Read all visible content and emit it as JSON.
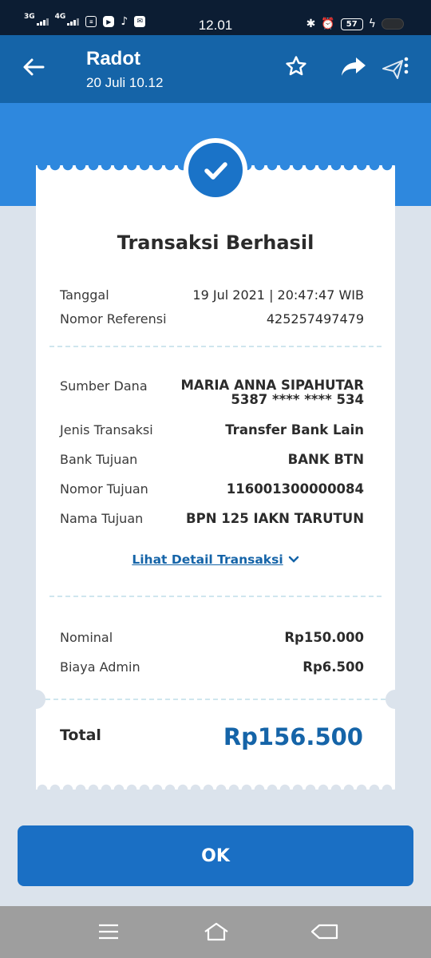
{
  "status_bar": {
    "network1": "3G",
    "network2": "4G",
    "time": "12.01",
    "battery": "57"
  },
  "header": {
    "sender": "Radot",
    "date": "20 Juli 10.12"
  },
  "receipt": {
    "title": "Transaksi Berhasil",
    "info": [
      {
        "label": "Tanggal",
        "value": "19 Jul 2021 | 20:47:47 WIB"
      },
      {
        "label": "Nomor Referensi",
        "value": "425257497479"
      }
    ],
    "source": {
      "label": "Sumber Dana",
      "name": "MARIA ANNA SIPAHUTAR",
      "account": "5387 **** **** 534"
    },
    "details": [
      {
        "label": "Jenis Transaksi",
        "value": "Transfer Bank Lain"
      },
      {
        "label": "Bank Tujuan",
        "value": "BANK BTN"
      },
      {
        "label": "Nomor Tujuan",
        "value": "116001300000084"
      },
      {
        "label": "Nama Tujuan",
        "value": "BPN 125 IAKN TARUTUN"
      }
    ],
    "detail_link": "Lihat Detail Transaksi",
    "amounts": [
      {
        "label": "Nominal",
        "value": "Rp150.000"
      },
      {
        "label": "Biaya Admin",
        "value": "Rp6.500"
      }
    ],
    "total_label": "Total",
    "total_value": "Rp156.500"
  },
  "ok_label": "OK",
  "colors": {
    "primary": "#1564a8",
    "band": "#2e88de",
    "button": "#1a6fc4",
    "background": "#dbe3ec"
  }
}
